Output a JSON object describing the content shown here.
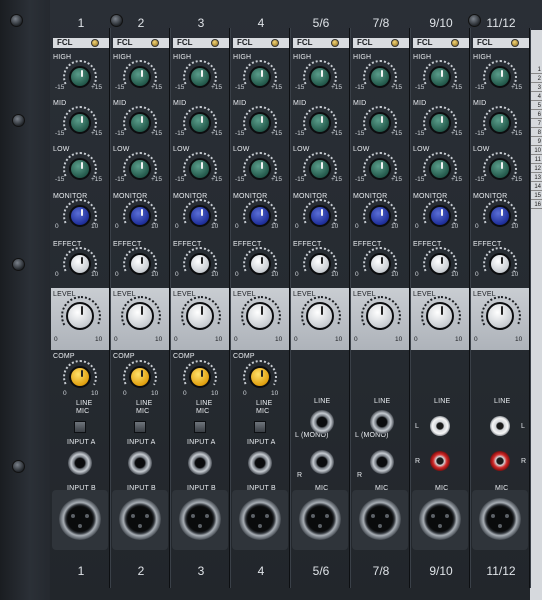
{
  "channels": [
    {
      "name": "1",
      "bottom": "1",
      "fcl": "FCL",
      "type": "mono"
    },
    {
      "name": "2",
      "bottom": "2",
      "fcl": "FCL",
      "type": "mono"
    },
    {
      "name": "3",
      "bottom": "3",
      "fcl": "FCL",
      "type": "mono"
    },
    {
      "name": "4",
      "bottom": "4",
      "fcl": "FCL",
      "type": "mono"
    },
    {
      "name": "5/6",
      "bottom": "5/6",
      "fcl": "FCL",
      "type": "stereo"
    },
    {
      "name": "7/8",
      "bottom": "7/8",
      "fcl": "FCL",
      "type": "stereo"
    },
    {
      "name": "9/10",
      "bottom": "9/10",
      "fcl": "FCL",
      "type": "rca"
    },
    {
      "name": "11/12",
      "bottom": "11/12",
      "fcl": "FCL",
      "type": "rca"
    }
  ],
  "labels": {
    "high": "HIGH",
    "mid": "MID",
    "low": "LOW",
    "monitor": "MONITOR",
    "effect": "EFFECT",
    "level": "LEVEL",
    "comp": "COMP",
    "line": "LINE",
    "mic": "MIC",
    "input_a": "INPUT A",
    "input_b": "INPUT B",
    "l_mono": "L (MONO)",
    "l": "L",
    "r": "R"
  },
  "scales": {
    "eq_min": "-15",
    "eq_max": "+15",
    "zero": "0",
    "ten": "10"
  },
  "bus_numbers": [
    "1",
    "2",
    "3",
    "4",
    "5",
    "6",
    "7",
    "8",
    "9",
    "10",
    "11",
    "12",
    "13",
    "14",
    "15",
    "16"
  ],
  "colors": {
    "eq_knob": "#23594b",
    "monitor_knob": "#1f2f9a",
    "effect_knob": "#ffffff",
    "comp_knob": "#e0a010"
  }
}
